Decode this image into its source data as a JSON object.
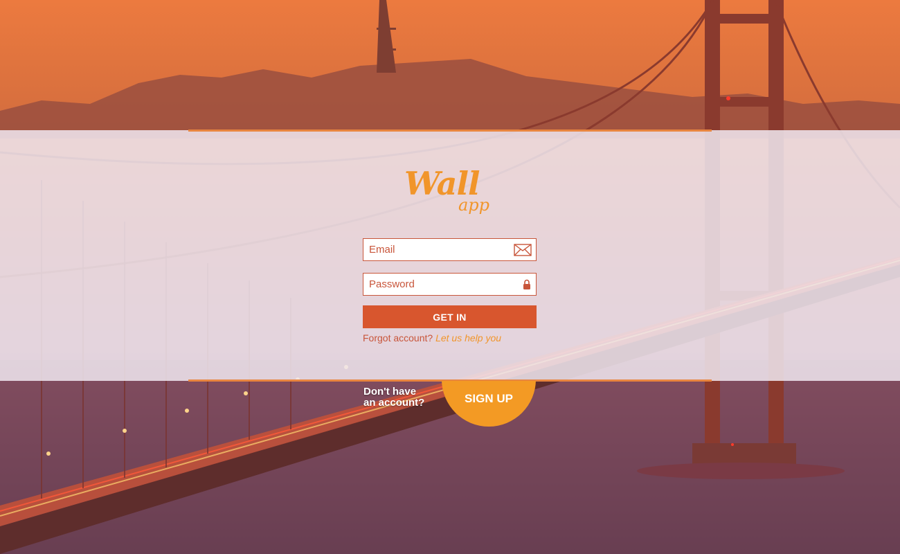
{
  "brand": {
    "logo_main": "Wall",
    "logo_sub": "app",
    "accent_color": "#f1952a",
    "primary_color": "#d8562e"
  },
  "login": {
    "email_placeholder": "Email",
    "password_placeholder": "Password",
    "email_icon": "envelope-icon",
    "password_icon": "lock-icon",
    "submit_label": "GET IN",
    "forgot_text": "Forgot account?",
    "forgot_link": "Let us help you"
  },
  "signup": {
    "prompt_line1": "Don't have",
    "prompt_line2": "an account?",
    "button_label": "SIGN UP"
  }
}
